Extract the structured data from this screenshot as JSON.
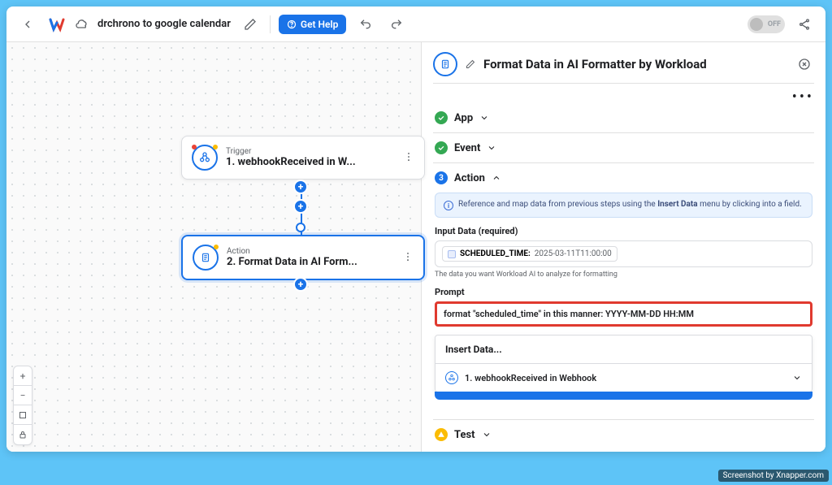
{
  "header": {
    "title": "drchrono to google calendar",
    "help_label": "Get Help",
    "toggle_label": "OFF"
  },
  "canvas": {
    "node1": {
      "kicker": "Trigger",
      "title": "1. webhookReceived in W..."
    },
    "node2": {
      "kicker": "Action",
      "title": "2. Format Data in AI Form..."
    }
  },
  "panel": {
    "title": "Format Data in AI Formatter by Workload",
    "sections": {
      "app": "App",
      "event": "Event",
      "action": "Action",
      "test": "Test"
    },
    "action": {
      "info_prefix": "Reference and map data from previous steps using the ",
      "info_strong": "Insert Data",
      "info_suffix": " menu by clicking into a field.",
      "input_label": "Input Data (required)",
      "pill_key": "SCHEDULED_TIME:",
      "pill_value": "2025-03-11T11:00:00",
      "input_help": "The data you want Workload AI to analyze for formatting",
      "prompt_label": "Prompt",
      "prompt_value": "format \"scheduled_time\" in this manner: YYYY-MM-DD HH:MM",
      "insert_title": "Insert Data...",
      "insert_item": "1. webhookReceived in Webhook"
    }
  },
  "zoom": {
    "plus": "+",
    "minus": "−"
  },
  "footer": {
    "badge": "Screenshot by Xnapper.com"
  }
}
